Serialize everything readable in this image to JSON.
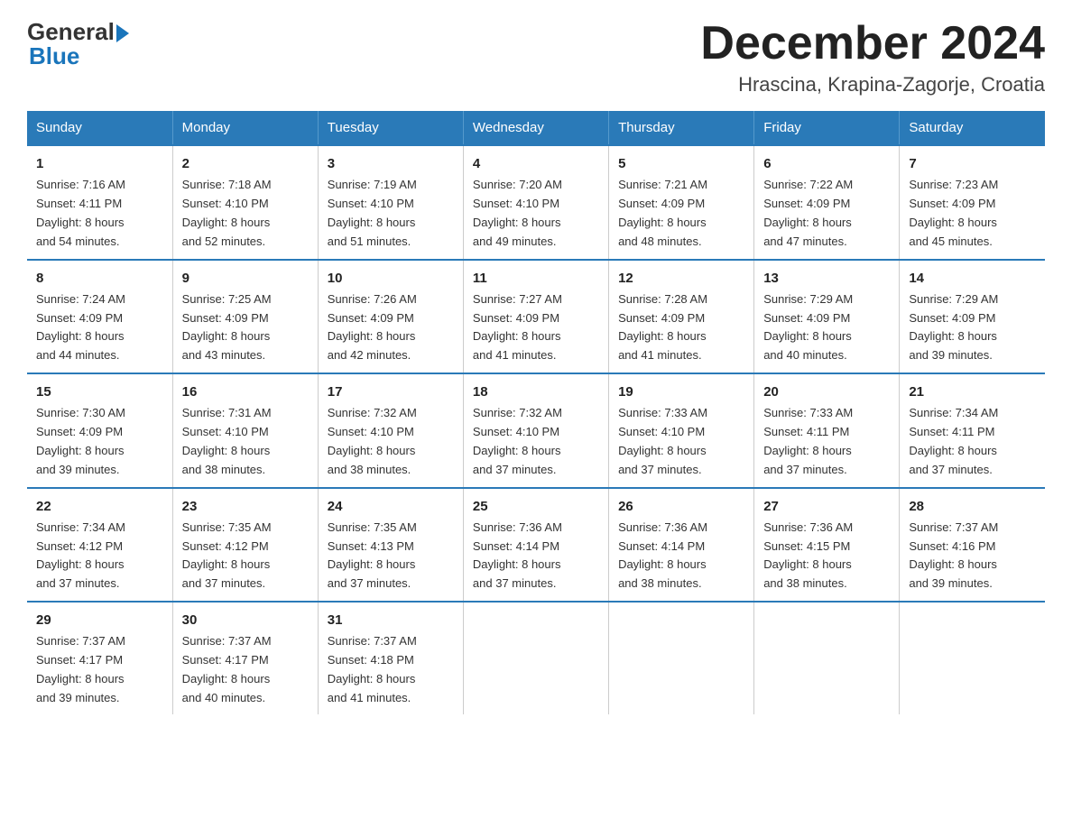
{
  "header": {
    "logo_general": "General",
    "logo_blue": "Blue",
    "title": "December 2024",
    "subtitle": "Hrascina, Krapina-Zagorje, Croatia"
  },
  "days_of_week": [
    "Sunday",
    "Monday",
    "Tuesday",
    "Wednesday",
    "Thursday",
    "Friday",
    "Saturday"
  ],
  "weeks": [
    [
      {
        "day": "1",
        "sunrise": "7:16 AM",
        "sunset": "4:11 PM",
        "daylight": "8 hours and 54 minutes."
      },
      {
        "day": "2",
        "sunrise": "7:18 AM",
        "sunset": "4:10 PM",
        "daylight": "8 hours and 52 minutes."
      },
      {
        "day": "3",
        "sunrise": "7:19 AM",
        "sunset": "4:10 PM",
        "daylight": "8 hours and 51 minutes."
      },
      {
        "day": "4",
        "sunrise": "7:20 AM",
        "sunset": "4:10 PM",
        "daylight": "8 hours and 49 minutes."
      },
      {
        "day": "5",
        "sunrise": "7:21 AM",
        "sunset": "4:09 PM",
        "daylight": "8 hours and 48 minutes."
      },
      {
        "day": "6",
        "sunrise": "7:22 AM",
        "sunset": "4:09 PM",
        "daylight": "8 hours and 47 minutes."
      },
      {
        "day": "7",
        "sunrise": "7:23 AM",
        "sunset": "4:09 PM",
        "daylight": "8 hours and 45 minutes."
      }
    ],
    [
      {
        "day": "8",
        "sunrise": "7:24 AM",
        "sunset": "4:09 PM",
        "daylight": "8 hours and 44 minutes."
      },
      {
        "day": "9",
        "sunrise": "7:25 AM",
        "sunset": "4:09 PM",
        "daylight": "8 hours and 43 minutes."
      },
      {
        "day": "10",
        "sunrise": "7:26 AM",
        "sunset": "4:09 PM",
        "daylight": "8 hours and 42 minutes."
      },
      {
        "day": "11",
        "sunrise": "7:27 AM",
        "sunset": "4:09 PM",
        "daylight": "8 hours and 41 minutes."
      },
      {
        "day": "12",
        "sunrise": "7:28 AM",
        "sunset": "4:09 PM",
        "daylight": "8 hours and 41 minutes."
      },
      {
        "day": "13",
        "sunrise": "7:29 AM",
        "sunset": "4:09 PM",
        "daylight": "8 hours and 40 minutes."
      },
      {
        "day": "14",
        "sunrise": "7:29 AM",
        "sunset": "4:09 PM",
        "daylight": "8 hours and 39 minutes."
      }
    ],
    [
      {
        "day": "15",
        "sunrise": "7:30 AM",
        "sunset": "4:09 PM",
        "daylight": "8 hours and 39 minutes."
      },
      {
        "day": "16",
        "sunrise": "7:31 AM",
        "sunset": "4:10 PM",
        "daylight": "8 hours and 38 minutes."
      },
      {
        "day": "17",
        "sunrise": "7:32 AM",
        "sunset": "4:10 PM",
        "daylight": "8 hours and 38 minutes."
      },
      {
        "day": "18",
        "sunrise": "7:32 AM",
        "sunset": "4:10 PM",
        "daylight": "8 hours and 37 minutes."
      },
      {
        "day": "19",
        "sunrise": "7:33 AM",
        "sunset": "4:10 PM",
        "daylight": "8 hours and 37 minutes."
      },
      {
        "day": "20",
        "sunrise": "7:33 AM",
        "sunset": "4:11 PM",
        "daylight": "8 hours and 37 minutes."
      },
      {
        "day": "21",
        "sunrise": "7:34 AM",
        "sunset": "4:11 PM",
        "daylight": "8 hours and 37 minutes."
      }
    ],
    [
      {
        "day": "22",
        "sunrise": "7:34 AM",
        "sunset": "4:12 PM",
        "daylight": "8 hours and 37 minutes."
      },
      {
        "day": "23",
        "sunrise": "7:35 AM",
        "sunset": "4:12 PM",
        "daylight": "8 hours and 37 minutes."
      },
      {
        "day": "24",
        "sunrise": "7:35 AM",
        "sunset": "4:13 PM",
        "daylight": "8 hours and 37 minutes."
      },
      {
        "day": "25",
        "sunrise": "7:36 AM",
        "sunset": "4:14 PM",
        "daylight": "8 hours and 37 minutes."
      },
      {
        "day": "26",
        "sunrise": "7:36 AM",
        "sunset": "4:14 PM",
        "daylight": "8 hours and 38 minutes."
      },
      {
        "day": "27",
        "sunrise": "7:36 AM",
        "sunset": "4:15 PM",
        "daylight": "8 hours and 38 minutes."
      },
      {
        "day": "28",
        "sunrise": "7:37 AM",
        "sunset": "4:16 PM",
        "daylight": "8 hours and 39 minutes."
      }
    ],
    [
      {
        "day": "29",
        "sunrise": "7:37 AM",
        "sunset": "4:17 PM",
        "daylight": "8 hours and 39 minutes."
      },
      {
        "day": "30",
        "sunrise": "7:37 AM",
        "sunset": "4:17 PM",
        "daylight": "8 hours and 40 minutes."
      },
      {
        "day": "31",
        "sunrise": "7:37 AM",
        "sunset": "4:18 PM",
        "daylight": "8 hours and 41 minutes."
      },
      null,
      null,
      null,
      null
    ]
  ],
  "labels": {
    "sunrise": "Sunrise:",
    "sunset": "Sunset:",
    "daylight": "Daylight:"
  }
}
